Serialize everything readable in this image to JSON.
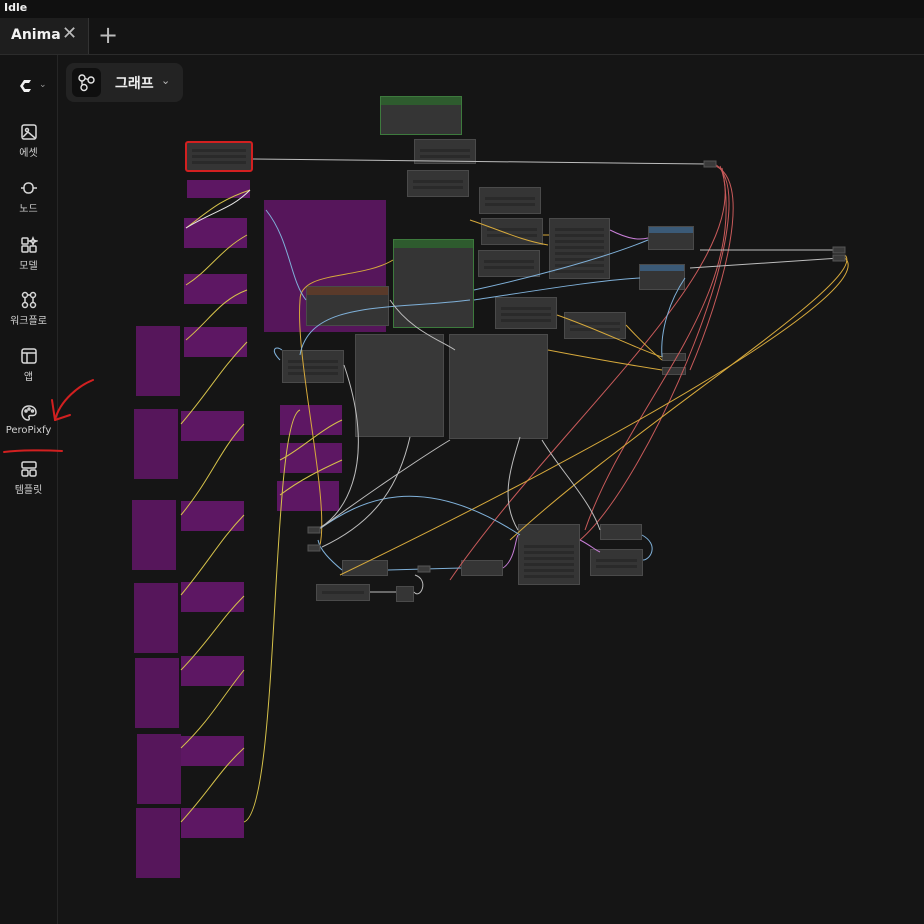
{
  "app": {
    "status": "Idle"
  },
  "tabs": [
    {
      "label": "Anima"
    }
  ],
  "sidebar": {
    "items": [
      {
        "label": "에셋",
        "icon": "image-icon"
      },
      {
        "label": "노드",
        "icon": "node-icon"
      },
      {
        "label": "모델",
        "icon": "model-icon"
      },
      {
        "label": "워크플로",
        "icon": "workflow-icon"
      },
      {
        "label": "앱",
        "icon": "app-layout-icon"
      },
      {
        "label": "PeroPixfy",
        "icon": "palette-icon"
      },
      {
        "label": "템플릿",
        "icon": "template-icon"
      }
    ]
  },
  "canvas": {
    "view_mode": "그래프"
  },
  "colors": {
    "annotation": "#d22020",
    "group": "#56165b",
    "node": "#353535",
    "green_header": "#2e5b2e"
  }
}
